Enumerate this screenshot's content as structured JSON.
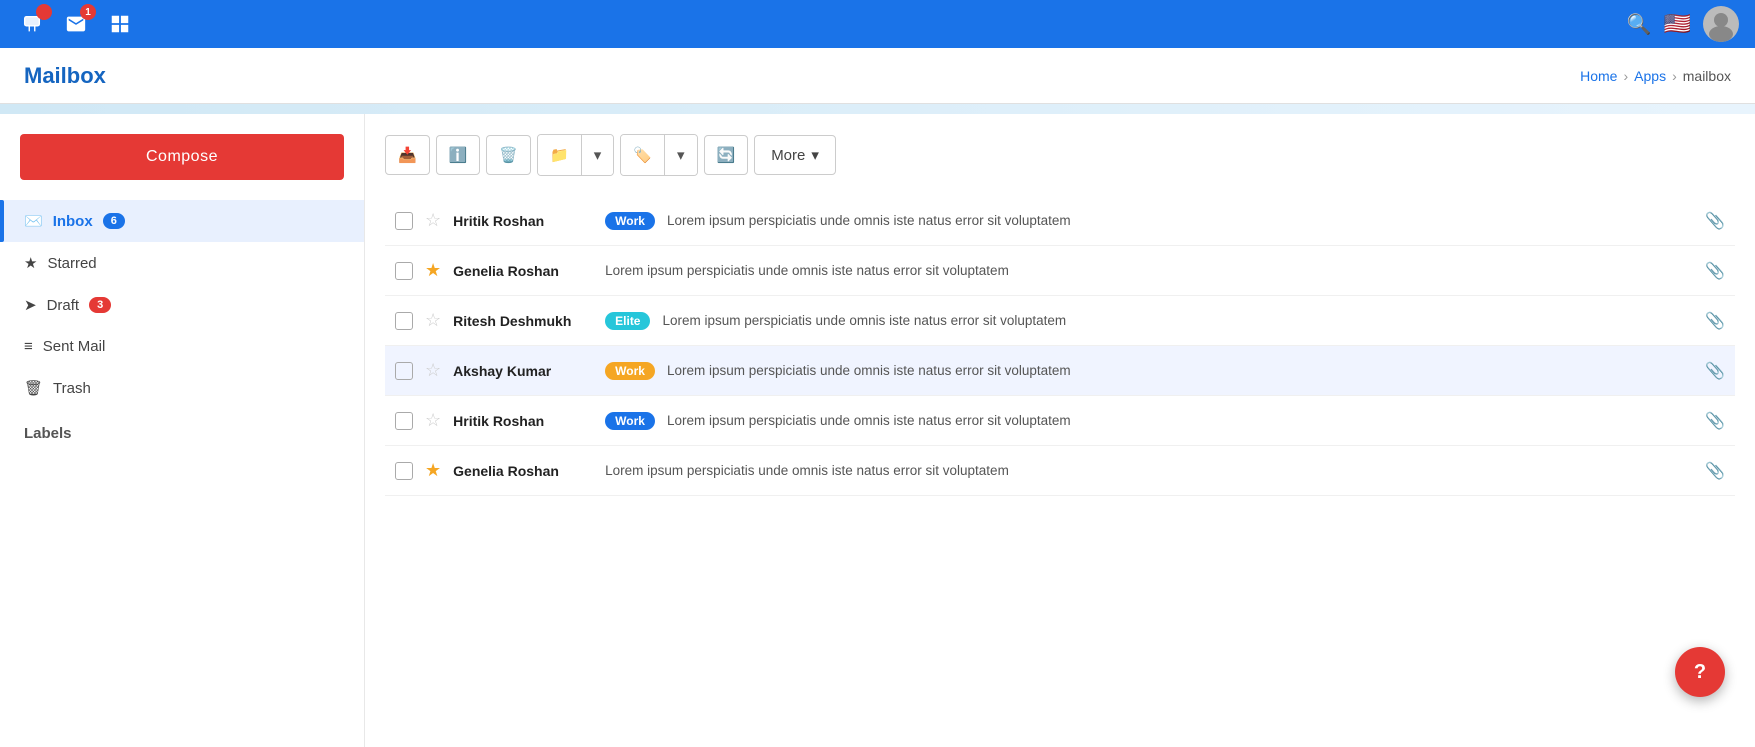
{
  "topNav": {
    "icons": [
      {
        "name": "flag-icon",
        "badge": null
      },
      {
        "name": "mail-icon",
        "badge": "1"
      },
      {
        "name": "grid-icon",
        "badge": null
      }
    ],
    "right": {
      "searchTitle": "Search",
      "flagAlt": "US Flag",
      "avatarAlt": "User Avatar"
    }
  },
  "breadcrumb": {
    "home": "Home",
    "apps": "Apps",
    "current": "mailbox"
  },
  "pageTitle": "Mailbox",
  "accentBar": true,
  "sidebar": {
    "composeLabel": "Compose",
    "items": [
      {
        "label": "Inbox",
        "icon": "inbox-icon",
        "badge": "6",
        "badgeType": "blue",
        "active": true
      },
      {
        "label": "Starred",
        "icon": "star-icon",
        "badge": null,
        "active": false
      },
      {
        "label": "Draft",
        "icon": "draft-icon",
        "badge": "3",
        "badgeType": "red",
        "active": false
      },
      {
        "label": "Sent Mail",
        "icon": "sent-icon",
        "badge": null,
        "active": false
      },
      {
        "label": "Trash",
        "icon": "trash-icon",
        "badge": null,
        "active": false
      }
    ],
    "sectionTitle": "Labels"
  },
  "toolbar": {
    "buttons": [
      {
        "name": "inbox-btn",
        "icon": "📥"
      },
      {
        "name": "info-btn",
        "icon": "ℹ️"
      },
      {
        "name": "delete-btn",
        "icon": "🗑️"
      }
    ],
    "groupBtn1": {
      "name": "folder-dropdown-btn",
      "icon": "📁",
      "hasArrow": true
    },
    "groupBtn2": {
      "name": "tag-dropdown-btn",
      "icon": "🏷️",
      "hasArrow": true
    },
    "refreshBtn": {
      "name": "refresh-btn",
      "icon": "🔄"
    },
    "moreBtn": {
      "label": "More",
      "hasArrow": true
    }
  },
  "emails": [
    {
      "sender": "Hritik Roshan",
      "tag": "Work",
      "tagType": "work",
      "preview": "Lorem ipsum perspiciatis unde omnis iste natus error sit voluptatem",
      "starred": false,
      "hasAttachment": true
    },
    {
      "sender": "Genelia Roshan",
      "tag": null,
      "tagType": null,
      "preview": "Lorem ipsum perspiciatis unde omnis iste natus error sit voluptatem",
      "starred": true,
      "hasAttachment": true
    },
    {
      "sender": "Ritesh Deshmukh",
      "tag": "Elite",
      "tagType": "elite",
      "preview": "Lorem ipsum perspiciatis unde omnis iste natus error sit voluptatem",
      "starred": false,
      "hasAttachment": true
    },
    {
      "sender": "Akshay Kumar",
      "tag": "Work",
      "tagType": "work-orange",
      "preview": "Lorem ipsum perspiciatis unde omnis iste natus error sit voluptatem",
      "starred": false,
      "hasAttachment": true,
      "highlighted": true
    },
    {
      "sender": "Hritik Roshan",
      "tag": "Work",
      "tagType": "work",
      "preview": "Lorem ipsum perspiciatis unde omnis iste natus error sit voluptatem",
      "starred": false,
      "hasAttachment": true
    },
    {
      "sender": "Genelia Roshan",
      "tag": null,
      "tagType": null,
      "preview": "Lorem ipsum perspiciatis unde omnis iste natus error sit voluptatem",
      "starred": true,
      "hasAttachment": true
    }
  ],
  "helpBtn": {
    "label": "?"
  }
}
